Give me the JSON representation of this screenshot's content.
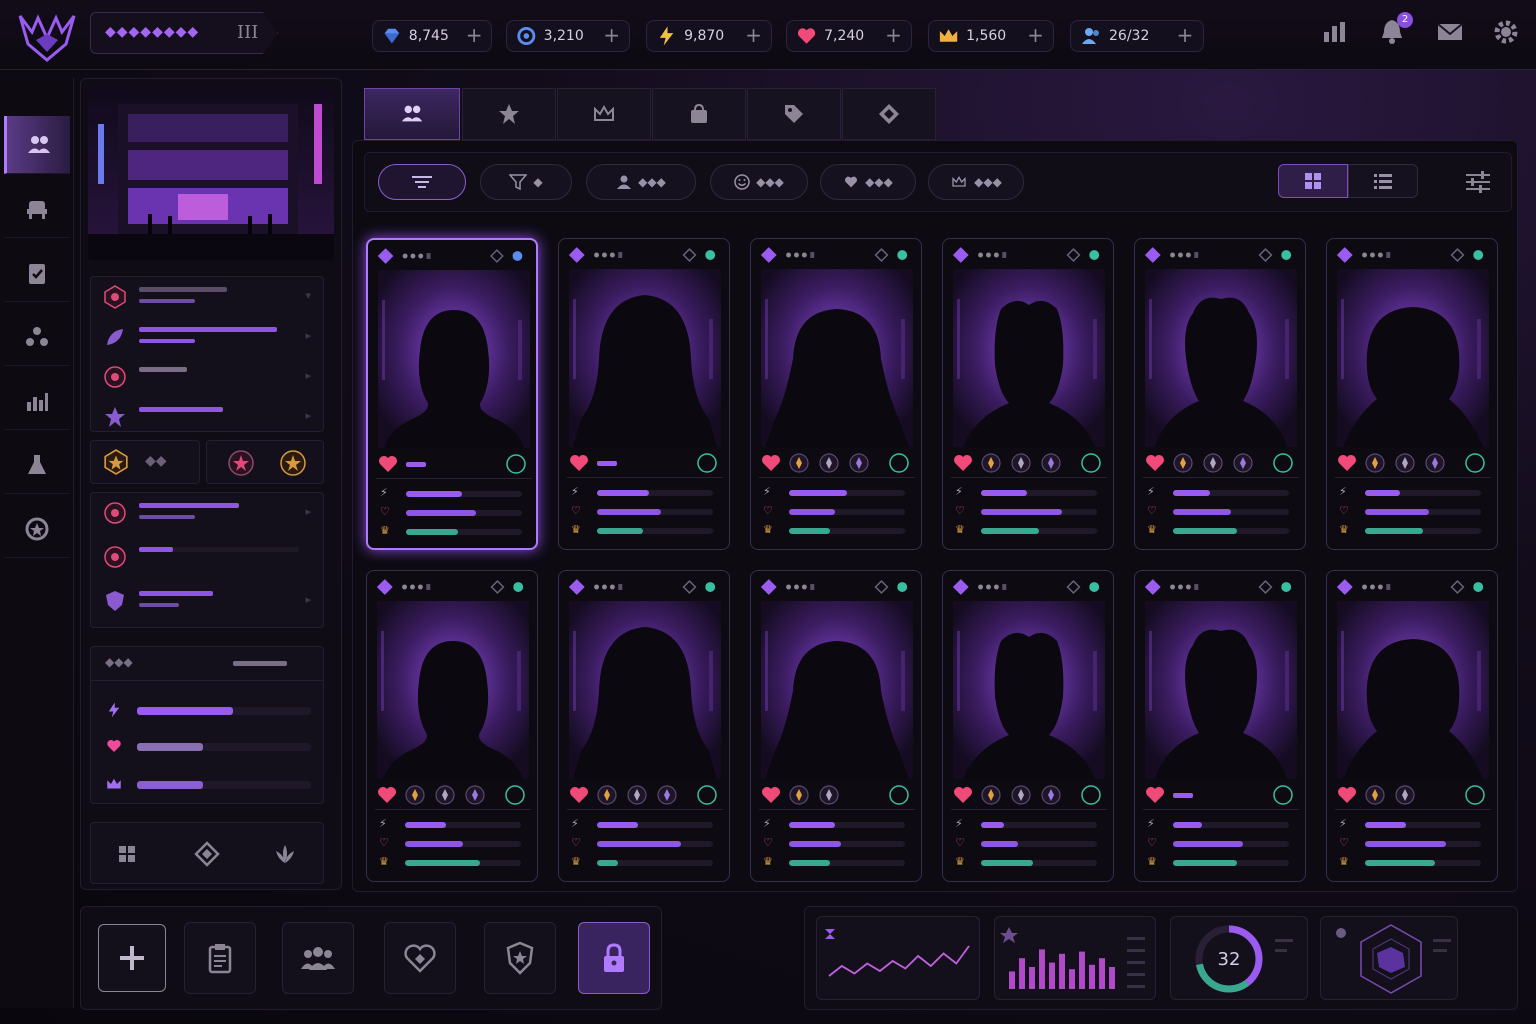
{
  "header": {
    "rank_dots": "◆◆◆◆◆◆◆◆",
    "rank_tier": "III",
    "resources": [
      {
        "icon": "diamond-icon",
        "value": "8,745",
        "color": "#5b8cf0"
      },
      {
        "icon": "gear-coin-icon",
        "value": "3,210",
        "color": "#5b8cf0"
      },
      {
        "icon": "lightning-icon",
        "value": "9,870",
        "color": "#f0c040"
      },
      {
        "icon": "heart-icon",
        "value": "7,240",
        "color": "#f04a78"
      },
      {
        "icon": "crown-icon",
        "value": "1,560",
        "color": "#f0b040"
      },
      {
        "icon": "people-icon",
        "value": "26/32",
        "color": "#6aa8f0"
      }
    ],
    "plus": "+",
    "notification_count": "2"
  },
  "nav": [
    "people-icon",
    "chair-icon",
    "clipboard-check-icon",
    "molecule-icon",
    "chart-icon",
    "flask-icon",
    "badge-icon"
  ],
  "tabs": [
    "people-icon",
    "star-icon",
    "crown-icon",
    "bag-icon",
    "tag-icon",
    "diamond-icon"
  ],
  "filters": {
    "more": "◆◆◆"
  },
  "cards": [
    {
      "selected": true,
      "stats": [
        0.48,
        0.6,
        0.45
      ],
      "hearts": 1
    },
    {
      "selected": false,
      "stats": [
        0.45,
        0.55,
        0.4
      ]
    },
    {
      "selected": false,
      "stats": [
        0.5,
        0.4,
        0.35
      ]
    },
    {
      "selected": false,
      "stats": [
        0.4,
        0.7,
        0.5
      ]
    },
    {
      "selected": false,
      "stats": [
        0.32,
        0.5,
        0.55
      ]
    },
    {
      "selected": false,
      "stats": [
        0.3,
        0.55,
        0.5
      ]
    },
    {
      "selected": false,
      "stats": [
        0.35,
        0.5,
        0.65
      ]
    },
    {
      "selected": false,
      "stats": [
        0.35,
        0.72,
        0.18
      ]
    },
    {
      "selected": false,
      "stats": [
        0.4,
        0.45,
        0.35
      ]
    },
    {
      "selected": false,
      "stats": [
        0.2,
        0.32,
        0.45
      ]
    },
    {
      "selected": false,
      "stats": [
        0.25,
        0.6,
        0.55
      ]
    },
    {
      "selected": false,
      "stats": [
        0.35,
        0.7,
        0.6
      ]
    }
  ],
  "side_summary": {
    "stats": [
      0.55,
      0.38,
      0.38
    ]
  },
  "bottom_buttons": [
    "plus-icon",
    "clipboard-icon",
    "group-icon",
    "heart-link-icon",
    "shield-star-icon",
    "lock-icon"
  ],
  "bottom_widgets": {
    "gauge_value": "32",
    "gauge_fraction": 0.72,
    "line": [
      0.3,
      0.5,
      0.35,
      0.55,
      0.4,
      0.6,
      0.45,
      0.7,
      0.5,
      0.75,
      0.55,
      0.9
    ],
    "bars": [
      0.4,
      0.7,
      0.5,
      0.9,
      0.6,
      0.8,
      0.45,
      0.85,
      0.55,
      0.7,
      0.5
    ]
  }
}
